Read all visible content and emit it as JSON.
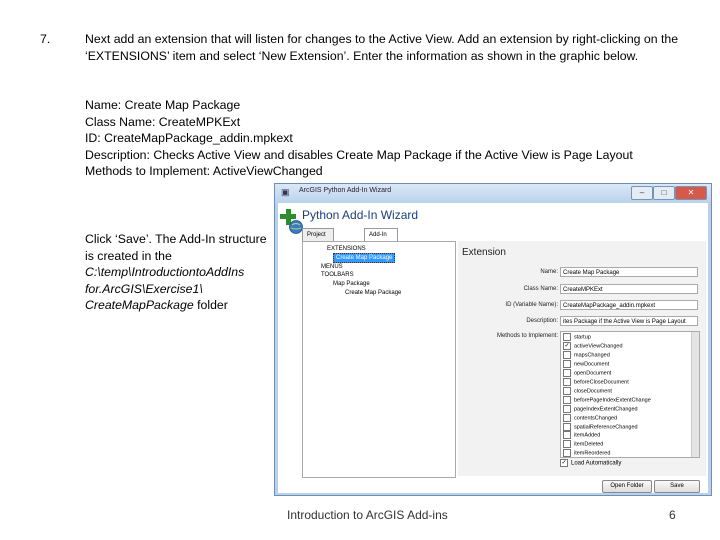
{
  "step": {
    "number": "7.",
    "text": "Next add an extension that will listen for changes to the Active View.  Add an extension by right-clicking on the ‘EXTENSIONS’ item and select ‘New Extension’.   Enter the information as shown in the graphic below."
  },
  "fields": [
    "Name: Create Map Package",
    "Class Name: CreateMPKExt",
    "ID: CreateMapPackage_addin.mpkext",
    "Description: Checks Active View and disables Create Map Package if the Active View is Page Layout",
    "Methods to Implement: ActiveViewChanged"
  ],
  "note": {
    "line1": "Click ‘Save’.  The Add-In structure is created in the",
    "path": "C:\\temp\\IntroductiontoAddIns for.ArcGIS\\Exercise1\\ CreateMapPackage",
    "suffix": " folder"
  },
  "footer": {
    "text": "Introduction to ArcGIS Add-ins",
    "page": "6"
  },
  "window": {
    "title": "ArcGIS Python Add-In Wizard",
    "header": "Python Add-In Wizard",
    "tabs": [
      "Project Settings",
      "Add-In Contents"
    ],
    "tree": [
      {
        "label": "EXTENSIONS",
        "indent": 1
      },
      {
        "label": "Create Map Package",
        "indent": 2,
        "selected": true
      },
      {
        "label": "MENUS",
        "indent": 1
      },
      {
        "label": "TOOLBARS",
        "indent": 1
      },
      {
        "label": "Map Package",
        "indent": 2
      },
      {
        "label": "Create Map Package",
        "indent": 3
      }
    ],
    "panel": {
      "title": "Extension",
      "name_label": "Name:",
      "name_value": "Create Map Package",
      "class_label": "Class Name:",
      "class_value": "CreateMPKExt",
      "id_label": "ID (Variable Name):",
      "id_value": "CreateMapPackage_addin.mpkext",
      "desc_label": "Description:",
      "desc_value": "ites Package if the Active View is Page Layout",
      "methods_label": "Methods to Implement:",
      "methods": [
        {
          "label": "startup",
          "checked": false
        },
        {
          "label": "activeViewChanged",
          "checked": true
        },
        {
          "label": "mapsChanged",
          "checked": false
        },
        {
          "label": "newDocument",
          "checked": false
        },
        {
          "label": "openDocument",
          "checked": false
        },
        {
          "label": "beforeCloseDocument",
          "checked": false
        },
        {
          "label": "closeDocument",
          "checked": false
        },
        {
          "label": "beforePageIndexExtentChange",
          "checked": false
        },
        {
          "label": "pageIndexExtentChanged",
          "checked": false
        },
        {
          "label": "contentsChanged",
          "checked": false
        },
        {
          "label": "spatialReferenceChanged",
          "checked": false
        },
        {
          "label": "itemAdded",
          "checked": false
        },
        {
          "label": "itemDeleted",
          "checked": false
        },
        {
          "label": "itemReordered",
          "checked": false
        }
      ],
      "load_label": "Load Automatically"
    },
    "buttons": {
      "open_folder": "Open Folder",
      "save": "Save"
    }
  }
}
